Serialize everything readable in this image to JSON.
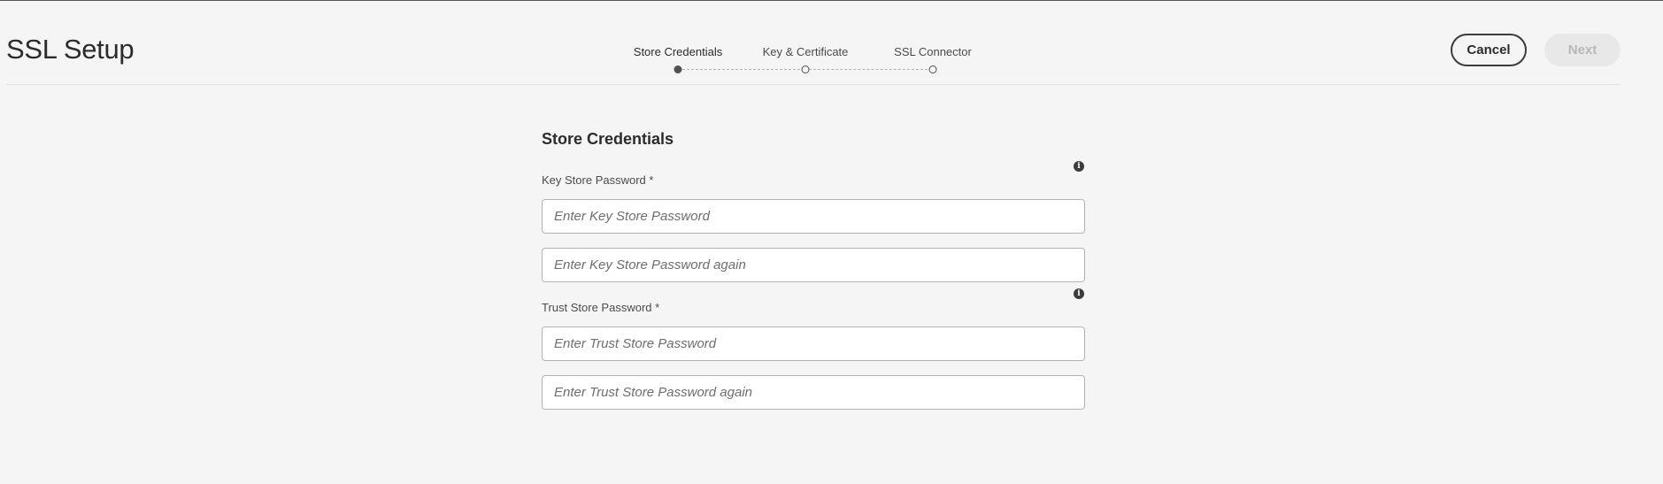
{
  "header": {
    "title": "SSL Setup",
    "cancel_label": "Cancel",
    "next_label": "Next"
  },
  "stepper": {
    "steps": [
      {
        "label": "Store Credentials",
        "state": "active"
      },
      {
        "label": "Key & Certificate",
        "state": "pending"
      },
      {
        "label": "SSL Connector",
        "state": "pending"
      }
    ]
  },
  "form": {
    "section_title": "Store Credentials",
    "key_store": {
      "label": "Key Store Password *",
      "info_icon": "info-icon",
      "password_placeholder": "Enter Key Store Password",
      "password_value": "",
      "confirm_placeholder": "Enter Key Store Password again",
      "confirm_value": ""
    },
    "trust_store": {
      "label": "Trust Store Password *",
      "info_icon": "info-icon",
      "password_placeholder": "Enter Trust Store Password",
      "password_value": "",
      "confirm_placeholder": "Enter Trust Store Password again",
      "confirm_value": ""
    }
  },
  "colors": {
    "background": "#f5f5f5",
    "text": "#2c2c2c",
    "next_disabled_bg": "#e8e8e8",
    "next_disabled_text": "#b8b8b8",
    "input_border": "#b3b3b3"
  }
}
